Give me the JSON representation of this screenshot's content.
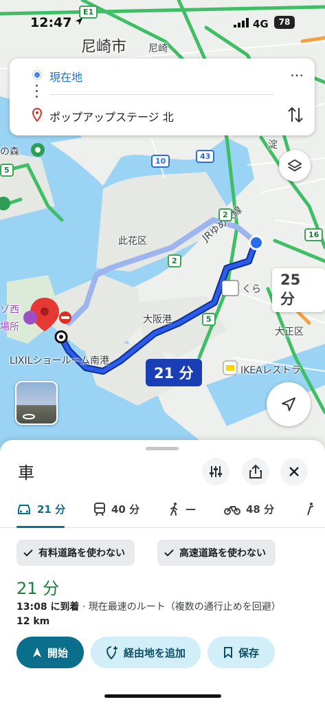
{
  "status_bar": {
    "time": "12:47",
    "network": "4G",
    "battery": "78"
  },
  "search": {
    "origin": "現在地",
    "destination": "ポップアップステージ 北",
    "more_icon": "more-vert-icon",
    "swap_icon": "swap-vert-icon"
  },
  "map": {
    "labels": {
      "amagasaki": "尼崎市",
      "amagasaki_jr": "尼崎",
      "konohana": "此花区",
      "taisho": "大正区",
      "osakako": "大阪港",
      "jr_line": "JRゆめ咲線",
      "lixil": "LIXILショールーム南港",
      "ikea": "IKEAレストラ",
      "kura": "くら",
      "forest": "の森",
      "west": "ゾ西",
      "place": "場所",
      "yodo": "淀"
    },
    "shields": {
      "e1": "E1",
      "r10": "10",
      "r43": "43",
      "r2a": "2",
      "r2b": "2",
      "r5a": "5",
      "r5b": "5",
      "r16": "16"
    },
    "route_times": {
      "primary": "21 分",
      "alternate": "25 分"
    },
    "colors": {
      "route_primary": "#1a3fb5",
      "route_alt": "#9db4ef",
      "water": "#9ad3f3",
      "land": "#eef0ed",
      "highway": "#3fbe66"
    }
  },
  "sheet": {
    "title": "車",
    "modes": [
      {
        "icon": "car-icon",
        "label": "21 分"
      },
      {
        "icon": "train-icon",
        "label": "40 分"
      },
      {
        "icon": "walk-icon",
        "label": "—"
      },
      {
        "icon": "bike-icon",
        "label": "48 分"
      }
    ],
    "chips": [
      "有料道路を使わない",
      "高速道路を使わない"
    ],
    "duration": "21 分",
    "arrival_time": "13:08 に到着",
    "arrival_note": " · 現在最速のルート（複数の通行止めを回避）",
    "distance": "12 km",
    "actions": {
      "start": "開始",
      "add_stop": "経由地を追加",
      "save": "保存"
    }
  }
}
